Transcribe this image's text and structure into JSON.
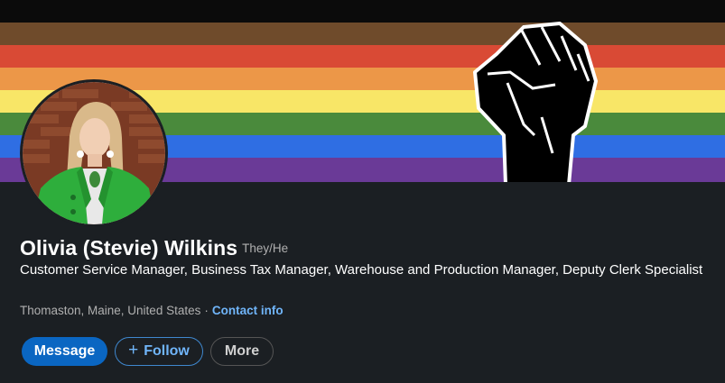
{
  "banner": {
    "stripes": [
      "#6f4b2b",
      "#e23b2e",
      "#f1903c",
      "#fbe85e",
      "#3b8a3e",
      "#2a6ee0",
      "#6b3a9e"
    ]
  },
  "profile": {
    "name": "Olivia (Stevie) Wilkins",
    "pronouns": "They/He",
    "headline": "Customer Service Manager, Business Tax Manager, Warehouse and Production Manager, Deputy Clerk Specialist",
    "location": "Thomaston, Maine, United States",
    "separator": "·",
    "contact_label": "Contact info"
  },
  "actions": {
    "message_label": "Message",
    "follow_label": "Follow",
    "follow_icon": "+",
    "more_label": "More"
  },
  "colors": {
    "accent": "#0a66c2",
    "link": "#70b5f9",
    "card_bg": "#1b1f23"
  }
}
